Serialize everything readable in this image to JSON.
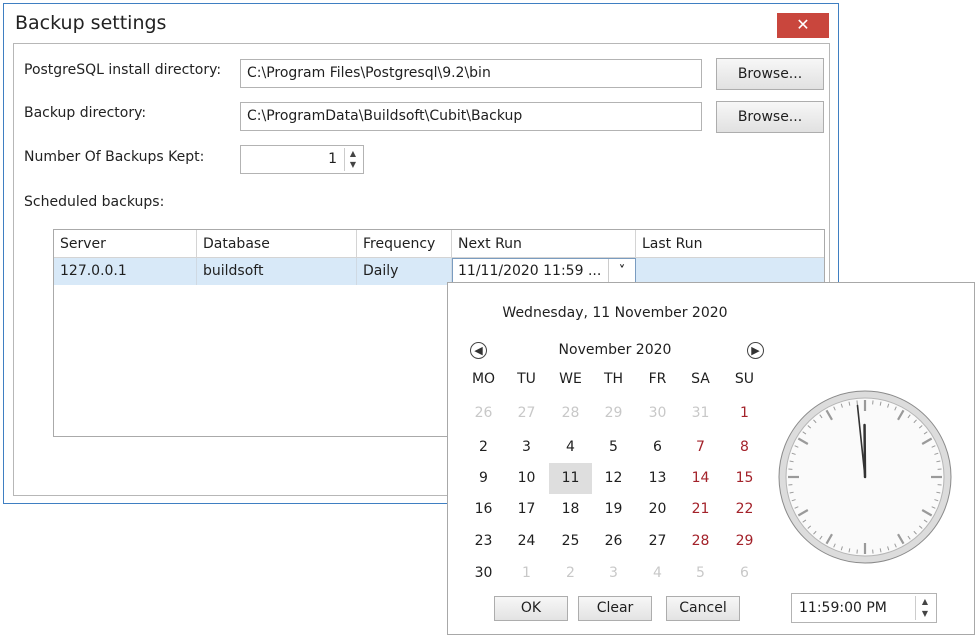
{
  "window": {
    "title": "Backup settings",
    "close_glyph": "✕"
  },
  "form": {
    "postgres_label": "PostgreSQL install directory:",
    "postgres_value": "C:\\Program Files\\Postgresql\\9.2\\bin",
    "backup_label": "Backup directory:",
    "backup_value": "C:\\ProgramData\\Buildsoft\\Cubit\\Backup",
    "browse_label": "Browse...",
    "kept_label": "Number Of Backups Kept:",
    "kept_value": "1",
    "scheduled_label": "Scheduled backups:"
  },
  "grid": {
    "columns": [
      "Server",
      "Database",
      "Frequency",
      "Next Run",
      "Last Run"
    ],
    "rows": [
      {
        "server": "127.0.0.1",
        "database": "buildsoft",
        "frequency": "Daily",
        "next_run": "11/11/2020 11:59 ...",
        "last_run": ""
      }
    ]
  },
  "calendar": {
    "long_date": "Wednesday, 11 November 2020",
    "month_label": "November 2020",
    "dow": [
      "MO",
      "TU",
      "WE",
      "TH",
      "FR",
      "SA",
      "SU"
    ],
    "weeks": [
      [
        "26",
        "27",
        "28",
        "29",
        "30",
        "31",
        "1"
      ],
      [
        "2",
        "3",
        "4",
        "5",
        "6",
        "7",
        "8"
      ],
      [
        "9",
        "10",
        "11",
        "12",
        "13",
        "14",
        "15"
      ],
      [
        "16",
        "17",
        "18",
        "19",
        "20",
        "21",
        "22"
      ],
      [
        "23",
        "24",
        "25",
        "26",
        "27",
        "28",
        "29"
      ],
      [
        "30",
        "1",
        "2",
        "3",
        "4",
        "5",
        "6"
      ]
    ],
    "selected_day": "11",
    "weekend_color": "#a3222a"
  },
  "popup": {
    "ok_label": "OK",
    "clear_label": "Clear",
    "cancel_label": "Cancel",
    "time_value": "11:59:00 PM",
    "clock_time": {
      "hour": 11,
      "minute": 59,
      "second": 0
    }
  },
  "colors": {
    "accent": "#3f7fc2",
    "close": "#c9463d",
    "selection": "#d8e9f8"
  }
}
